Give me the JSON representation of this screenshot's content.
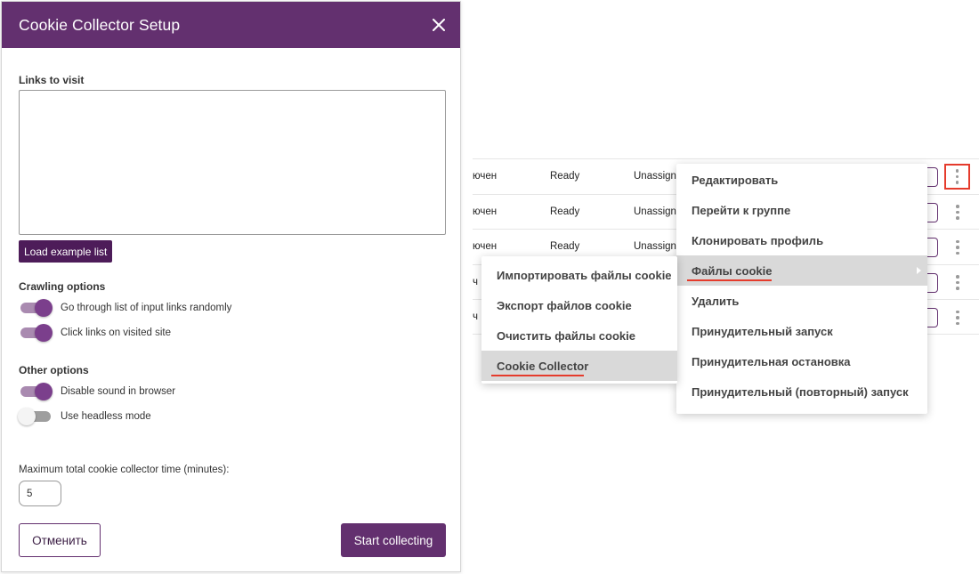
{
  "dialog": {
    "title": "Cookie Collector Setup",
    "links_label": "Links to visit",
    "links_value": "",
    "load_example_label": "Load example list",
    "crawling_label": "Crawling options",
    "crawling_toggles": [
      {
        "label": "Go through list of input links randomly",
        "on": true
      },
      {
        "label": "Click links on visited site",
        "on": true
      }
    ],
    "other_label": "Other options",
    "other_toggles": [
      {
        "label": "Disable sound in browser",
        "on": true
      },
      {
        "label": "Use headless mode",
        "on": false
      }
    ],
    "max_time_label": "Maximum total cookie collector time (minutes):",
    "max_time_value": "5",
    "cancel_label": "Отменить",
    "start_label": "Start collecting"
  },
  "table": {
    "rows": [
      {
        "name": "ючен",
        "status": "Ready",
        "group": "Unassign"
      },
      {
        "name": "ючен",
        "status": "Ready",
        "group": "Unassign"
      },
      {
        "name": "ючен",
        "status": "Ready",
        "group": "Unassign"
      },
      {
        "name": "ч",
        "status": "",
        "group": ""
      },
      {
        "name": "ч",
        "status": "",
        "group": ""
      }
    ]
  },
  "context_menu": {
    "items": [
      {
        "label": "Редактировать"
      },
      {
        "label": "Перейти к группе"
      },
      {
        "label": "Клонировать профиль"
      },
      {
        "label": "Файлы cookie",
        "active": true,
        "has_submenu": true
      },
      {
        "label": "Удалить"
      },
      {
        "label": "Принудительный запуск"
      },
      {
        "label": "Принудительная остановка"
      },
      {
        "label": "Принудительный (повторный) запуск"
      }
    ]
  },
  "submenu": {
    "items": [
      {
        "label": "Импортировать файлы cookie"
      },
      {
        "label": "Экспорт файлов cookie"
      },
      {
        "label": "Очистить файлы cookie"
      },
      {
        "label": "Cookie Collector",
        "active": true
      }
    ]
  },
  "colors": {
    "accent": "#63306f",
    "accent_dark": "#4d1c59",
    "highlight_red": "#e53b2c"
  }
}
